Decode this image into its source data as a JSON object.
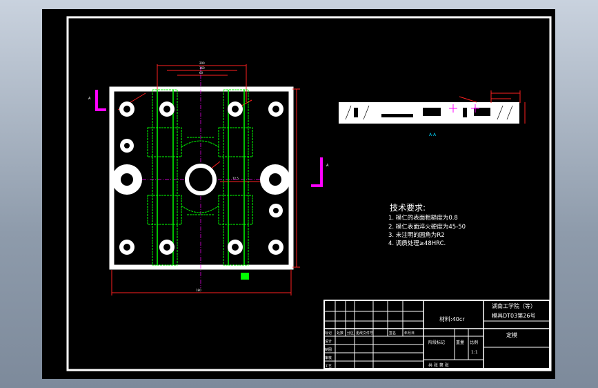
{
  "section_view": {
    "label": "A-A"
  },
  "tech_requirements": {
    "title": "技术要求:",
    "items": [
      "1. 模仁的表面粗糙度为0.8",
      "2. 模仁表面淬火硬度为45-50",
      "3. 未注明的圆角为R2",
      "4. 调质处理≥48HRC."
    ]
  },
  "title_block": {
    "school": "湖南工学院（等）",
    "drawing_no": "模具DT03第26号",
    "material": "材料:40cr",
    "part_name": "定模",
    "scale": "1:1",
    "row_labels": [
      "标记",
      "设计",
      "制图",
      "审核",
      "工艺"
    ],
    "col_labels": [
      "处数",
      "分区",
      "更改文件号",
      "签名",
      "年月日"
    ],
    "stage_label": "阶段标记",
    "weight_label": "重量",
    "scale_label": "比例",
    "sheet_text": "共 张 第 张"
  },
  "view_markers": {
    "left": "A",
    "right": "A"
  },
  "colors": {
    "frame": "#ffffff",
    "green": "#00ff00",
    "magenta": "#ff00ff",
    "cyan": "#00d7ff",
    "red": "#ff2020"
  }
}
